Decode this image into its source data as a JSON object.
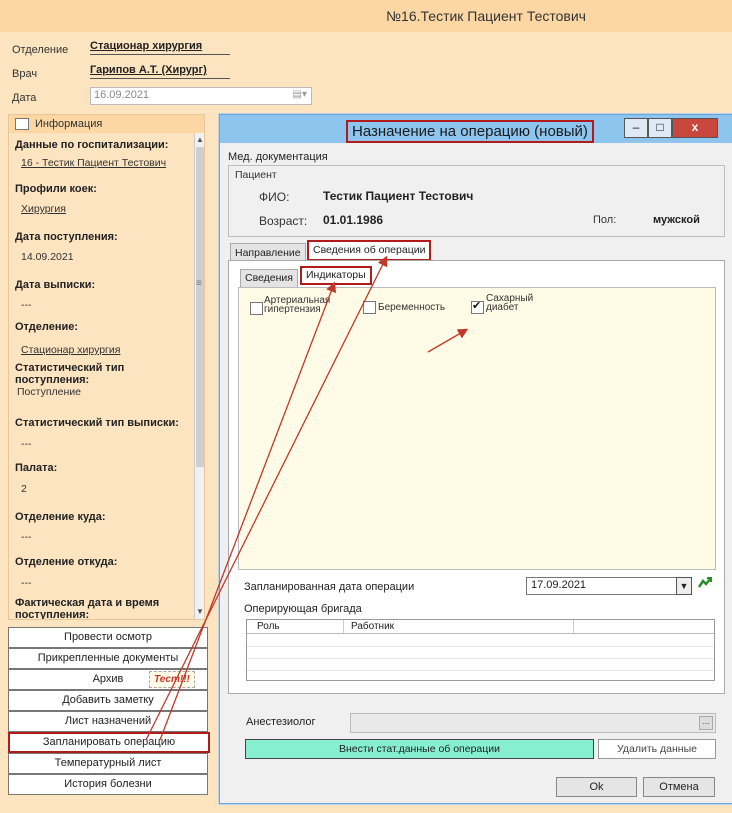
{
  "window": {
    "title": "№16.Тестик Пациент Тестович"
  },
  "header": {
    "dept_label": "Отделение",
    "dept_value": "Стационар хирургия",
    "doctor_label": "Врач",
    "doctor_value": "Гарипов А.Т. (Хирург)",
    "date_label": "Дата",
    "date_value": "16.09.2021"
  },
  "left_panel": {
    "title": "Информация",
    "items": [
      {
        "label": "Данные по госпитализации:",
        "value": "16 - Тестик Пациент Тестович"
      },
      {
        "label": "Профили коек:",
        "value": "Хирургия"
      },
      {
        "label": "Дата поступления:",
        "value": "14.09.2021"
      },
      {
        "label": "Дата выписки:",
        "value": "---"
      },
      {
        "label": "Отделение:",
        "value": "Стационар хирургия"
      },
      {
        "label": "Статистический тип поступления:",
        "value": "Поступление"
      },
      {
        "label": "Статистический тип выписки:",
        "value": "---"
      },
      {
        "label": "Палата:",
        "value": "2"
      },
      {
        "label": "Отделение куда:",
        "value": "---"
      },
      {
        "label": "Отделение откуда:",
        "value": "---"
      },
      {
        "label": "Фактическая дата и время поступления:",
        "value": ""
      }
    ]
  },
  "left_buttons": {
    "exam": "Провести осмотр",
    "docs": "Прикрепленные документы",
    "archive": "Архив",
    "archive_badge": "Тест!!!",
    "note": "Добавить заметку",
    "prescriptions": "Лист назначений",
    "plan_op": "Запланировать операцию",
    "temp": "Температурный лист",
    "history": "История болезни"
  },
  "dialog": {
    "title": "Назначение на операцию (новый)",
    "win_min": "–",
    "win_max": "□",
    "win_close": "x",
    "med_doc": "Мед. документация",
    "patient_group": "Пациент",
    "fio_label": "ФИО:",
    "fio_value": "Тестик Пациент Тестович",
    "age_label": "Возраст:",
    "age_value": "01.01.1986",
    "sex_label": "Пол:",
    "sex_value": "мужской",
    "tabs": [
      "Направление",
      "Сведения об операции"
    ],
    "subtabs": [
      "Сведения",
      "Индикаторы"
    ],
    "indicators": [
      {
        "label": "Артериальная гипертензия",
        "checked": false
      },
      {
        "label": "Беременность",
        "checked": false
      },
      {
        "label": "Сахарный диабет",
        "checked": true
      }
    ],
    "planned_date_label": "Запланированная дата операции",
    "planned_date_value": "17.09.2021",
    "team_label": "Оперирующая бригада",
    "team_columns": [
      "Роль",
      "Работник"
    ],
    "anesthesiologist_label": "Анестезиолог",
    "anes_btn": "...",
    "enter_stat_btn": "Внести стат.данные об операции",
    "delete_btn": "Удалить данные",
    "ok_btn": "Ok",
    "cancel_btn": "Отмена"
  },
  "colors": {
    "accent_red": "#b01b1b",
    "dialog_title": "#8ec5ee",
    "green_btn": "#86efcf",
    "panel_bg": "#fce4c0"
  }
}
